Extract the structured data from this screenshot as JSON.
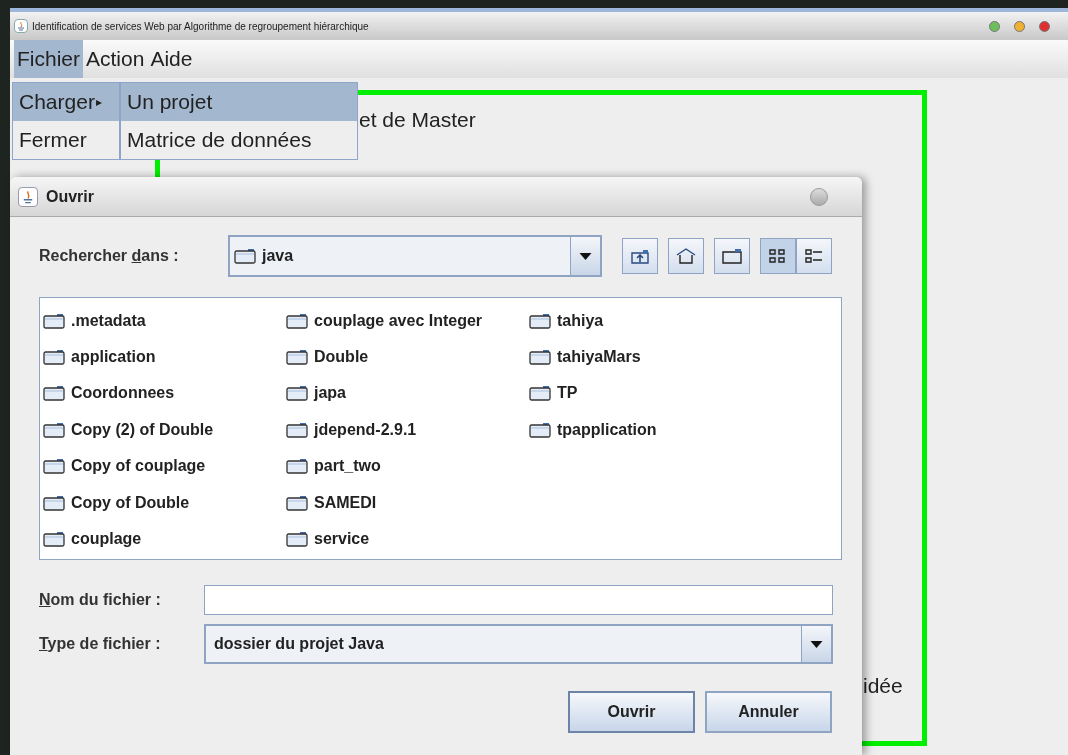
{
  "window": {
    "title": "Identification de services Web par Algorithme de regroupement hiérarchique"
  },
  "menu_bar": [
    {
      "label": "Fichier",
      "selected": true
    },
    {
      "label": "Action",
      "selected": false
    },
    {
      "label": "Aide",
      "selected": false
    }
  ],
  "menu": {
    "items": [
      {
        "label": "Charger",
        "selected": true,
        "arrow": "▸"
      },
      {
        "label": "Fermer",
        "selected": false
      }
    ],
    "submenu": [
      {
        "label": "Un projet",
        "selected": true
      },
      {
        "label": "Matrice de données",
        "selected": false
      }
    ]
  },
  "background_texts": [
    "et de Master",
    "idée"
  ],
  "dialog": {
    "title": "Ouvrir",
    "look_in": {
      "label": {
        "before": "Rechercher ",
        "mnemonic": "d",
        "after": "ans :"
      },
      "value": "java"
    },
    "toolbar": [
      {
        "kind": "up",
        "selected": false
      },
      {
        "kind": "home",
        "selected": false
      },
      {
        "kind": "new-folder",
        "selected": false
      },
      {
        "kind": "list",
        "selected": true
      },
      {
        "kind": "details",
        "selected": false
      }
    ],
    "files": [
      ".metadata",
      "application",
      "Coordonnees",
      "Copy (2) of Double",
      "Copy of couplage",
      "Copy of Double",
      "couplage",
      "couplage avec Integer",
      "Double",
      "japa",
      "jdepend-2.9.1",
      "part_two",
      "SAMEDI",
      "service",
      "tahiya",
      "tahiyaMars",
      "TP",
      "tpapplication"
    ],
    "file_name": {
      "label": {
        "mnemonic": "N",
        "after": "om du fichier :"
      }
    },
    "file_type": {
      "label": {
        "mnemonic": "T",
        "after": "ype de fichier :"
      },
      "value": "dossier du projet Java"
    },
    "buttons": [
      "Ouvrir",
      "Annuler"
    ]
  }
}
